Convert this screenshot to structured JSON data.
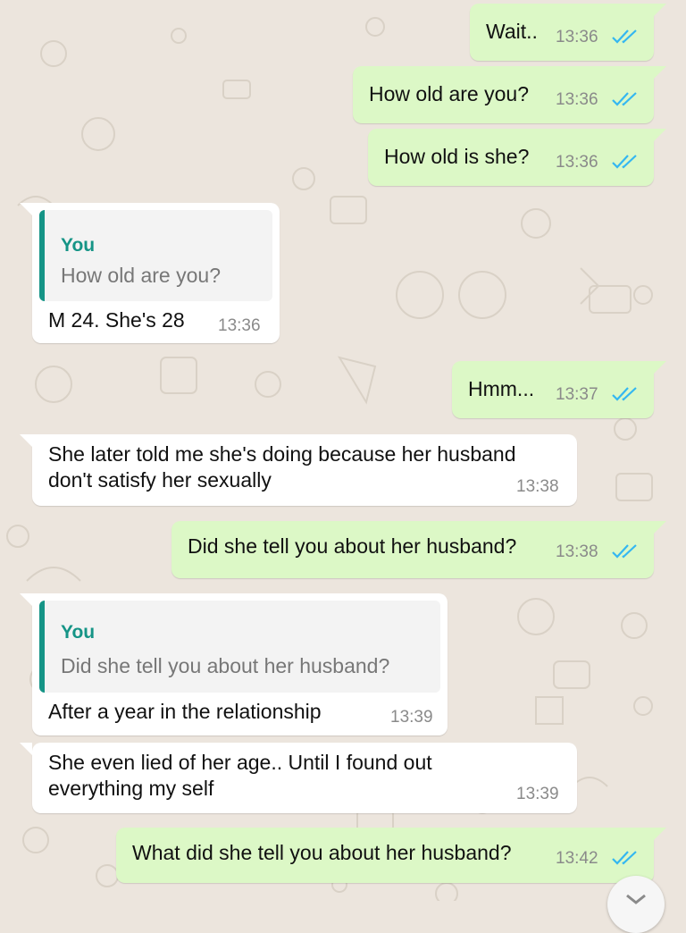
{
  "colors": {
    "outgoing_bubble": "#dcf8c6",
    "incoming_bubble": "#ffffff",
    "wallpaper": "#ece5dd",
    "read_ticks": "#34b7f1",
    "quote_accent": "#159486"
  },
  "messages": [
    {
      "direction": "outgoing",
      "text": "Wait..",
      "time": "13:36",
      "status": "read"
    },
    {
      "direction": "outgoing",
      "text": "How old are you?",
      "time": "13:36",
      "status": "read"
    },
    {
      "direction": "outgoing",
      "text": "How old is she?",
      "time": "13:36",
      "status": "read"
    },
    {
      "direction": "incoming",
      "quote_author": "You",
      "quote_text": "How old are you?",
      "text": "M 24. She's 28",
      "time": "13:36"
    },
    {
      "direction": "outgoing",
      "text": "Hmm...",
      "time": "13:37",
      "status": "read"
    },
    {
      "direction": "incoming",
      "text_line1": "She later told me she's doing because her husband",
      "text_line2": "don't satisfy her sexually",
      "time": "13:38"
    },
    {
      "direction": "outgoing",
      "text": "Did she tell you about her husband?",
      "time": "13:38",
      "status": "read"
    },
    {
      "direction": "incoming",
      "quote_author": "You",
      "quote_text": "Did she tell you about her husband?",
      "text": "After a year in the relationship",
      "time": "13:39"
    },
    {
      "direction": "incoming",
      "text_line1": "She even lied of her age.. Until I found out",
      "text_line2": "everything my self",
      "time": "13:39"
    },
    {
      "direction": "outgoing",
      "text": "What did she tell you about her husband?",
      "time": "13:42",
      "status": "read"
    }
  ],
  "scroll_button": {
    "icon": "chevron-down-icon"
  }
}
